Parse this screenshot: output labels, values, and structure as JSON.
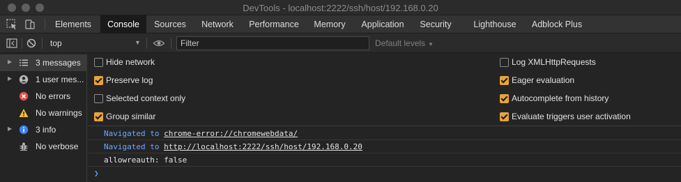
{
  "window": {
    "title": "DevTools - localhost:2222/ssh/host/192.168.0.20"
  },
  "tabs": [
    {
      "label": "Elements"
    },
    {
      "label": "Console"
    },
    {
      "label": "Sources"
    },
    {
      "label": "Network"
    },
    {
      "label": "Performance"
    },
    {
      "label": "Memory"
    },
    {
      "label": "Application"
    },
    {
      "label": "Security"
    },
    {
      "label": "Lighthouse"
    },
    {
      "label": "Adblock Plus"
    }
  ],
  "active_tab": "Console",
  "toolbar": {
    "context": "top",
    "filter_placeholder": "Filter",
    "levels_label": "Default levels"
  },
  "sidebar": {
    "items": [
      {
        "label": "3 messages",
        "icon": "list-icon",
        "selected": true
      },
      {
        "label": "1 user mes...",
        "icon": "user-icon"
      },
      {
        "label": "No errors",
        "icon": "error-icon",
        "color": "#e34d4d"
      },
      {
        "label": "No warnings",
        "icon": "warning-icon",
        "color": "#f2c037"
      },
      {
        "label": "3 info",
        "icon": "info-icon",
        "color": "#3b82f6"
      },
      {
        "label": "No verbose",
        "icon": "bug-icon"
      }
    ]
  },
  "settings": {
    "left": [
      {
        "label": "Hide network",
        "checked": false
      },
      {
        "label": "Preserve log",
        "checked": true
      },
      {
        "label": "Selected context only",
        "checked": false
      },
      {
        "label": "Group similar",
        "checked": true
      }
    ],
    "right": [
      {
        "label": "Log XMLHttpRequests",
        "checked": false
      },
      {
        "label": "Eager evaluation",
        "checked": true
      },
      {
        "label": "Autocomplete from history",
        "checked": true
      },
      {
        "label": "Evaluate triggers user activation",
        "checked": true
      }
    ]
  },
  "messages": [
    {
      "prefix": "Navigated to ",
      "link": "chrome-error://chromewebdata/"
    },
    {
      "prefix": "Navigated to ",
      "link": "http://localhost:2222/ssh/host/192.168.0.20"
    },
    {
      "text": "allowreauth: false"
    }
  ],
  "colors": {
    "accent_checkbox": "#e7a33c",
    "active_tab_bg": "#1a1a1a",
    "link_prefix": "#6ea7ff"
  }
}
